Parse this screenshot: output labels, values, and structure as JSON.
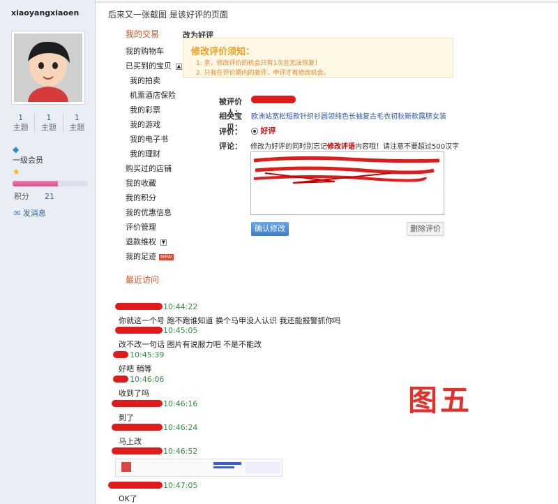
{
  "profile": {
    "username": "xiaoyangxiaoen",
    "stats": [
      {
        "num": "1",
        "label": "主题"
      },
      {
        "num": "1",
        "label": "主题"
      },
      {
        "num": "1",
        "label": "主题"
      }
    ],
    "level": "一级会员",
    "points_label": "积分",
    "points_value": "21",
    "points_bar_fraction": 0.6,
    "message_link": "发消息"
  },
  "header": {
    "caption": "后来又一张截图 是该好评的页面"
  },
  "nav": {
    "title": "我的交易",
    "items": [
      {
        "label": "我的购物车",
        "sub": false
      },
      {
        "label": "已买到的宝贝",
        "sub": false,
        "toggle": "▲"
      },
      {
        "label": "我的拍卖",
        "sub": true
      },
      {
        "label": "机票酒店保险",
        "sub": true
      },
      {
        "label": "我的彩票",
        "sub": true
      },
      {
        "label": "我的游戏",
        "sub": true
      },
      {
        "label": "我的电子书",
        "sub": true
      },
      {
        "label": "我的理财",
        "sub": true
      },
      {
        "label": "购买过的店铺",
        "sub": false
      },
      {
        "label": "我的收藏",
        "sub": false
      },
      {
        "label": "我的积分",
        "sub": false
      },
      {
        "label": "我的优惠信息",
        "sub": false
      },
      {
        "label": "评价管理",
        "sub": false
      },
      {
        "label": "退款维权",
        "sub": false,
        "toggle": "▼"
      },
      {
        "label": "我的足迹",
        "sub": false,
        "badge": "NEW"
      }
    ],
    "recent_title": "最近访问"
  },
  "panel": {
    "title": "改为好评",
    "notice_title": "修改评价须知：",
    "notice_lines": [
      "1. 亲，修改评价的机会只有1次且无法恢复！",
      "2. 只有在评价期内的差评，申评才有修改机会。"
    ],
    "reviewee_label": "被评价人：",
    "item_label": "相关宝贝：",
    "item_value": "欧洲站宽松短款针织衫圆领纯色长袖复古毛衣初秋新款露脐女装",
    "rating_label": "评价：",
    "rating_value": "好评",
    "comment_label": "评论：",
    "comment_hint_a": "修改为好评的同时别忘记",
    "comment_hint_b": "修改评语",
    "comment_hint_c": "内容哦！请注意不要超过500汉字",
    "confirm_button": "确认修改",
    "delete_button": "删除评价"
  },
  "chat": {
    "lines": [
      {
        "text": "你就这一个号 跑不跑谁知道 换个马甲没人认识 我还能报警抓你吗"
      },
      {
        "text": "改不改一句话 图片有说服力吧 不是不能改"
      },
      {
        "text": "好吧 稍等"
      },
      {
        "text": "收到了吗"
      },
      {
        "text": "到了"
      },
      {
        "text": "马上改"
      },
      {
        "text": "OK了"
      }
    ],
    "times": [
      "10:44:22",
      "10:45:05",
      "10:45:39",
      "10:46:06",
      "10:46:16",
      "10:46:24",
      "10:46:52",
      "10:47:05"
    ]
  },
  "stamp": "图五"
}
